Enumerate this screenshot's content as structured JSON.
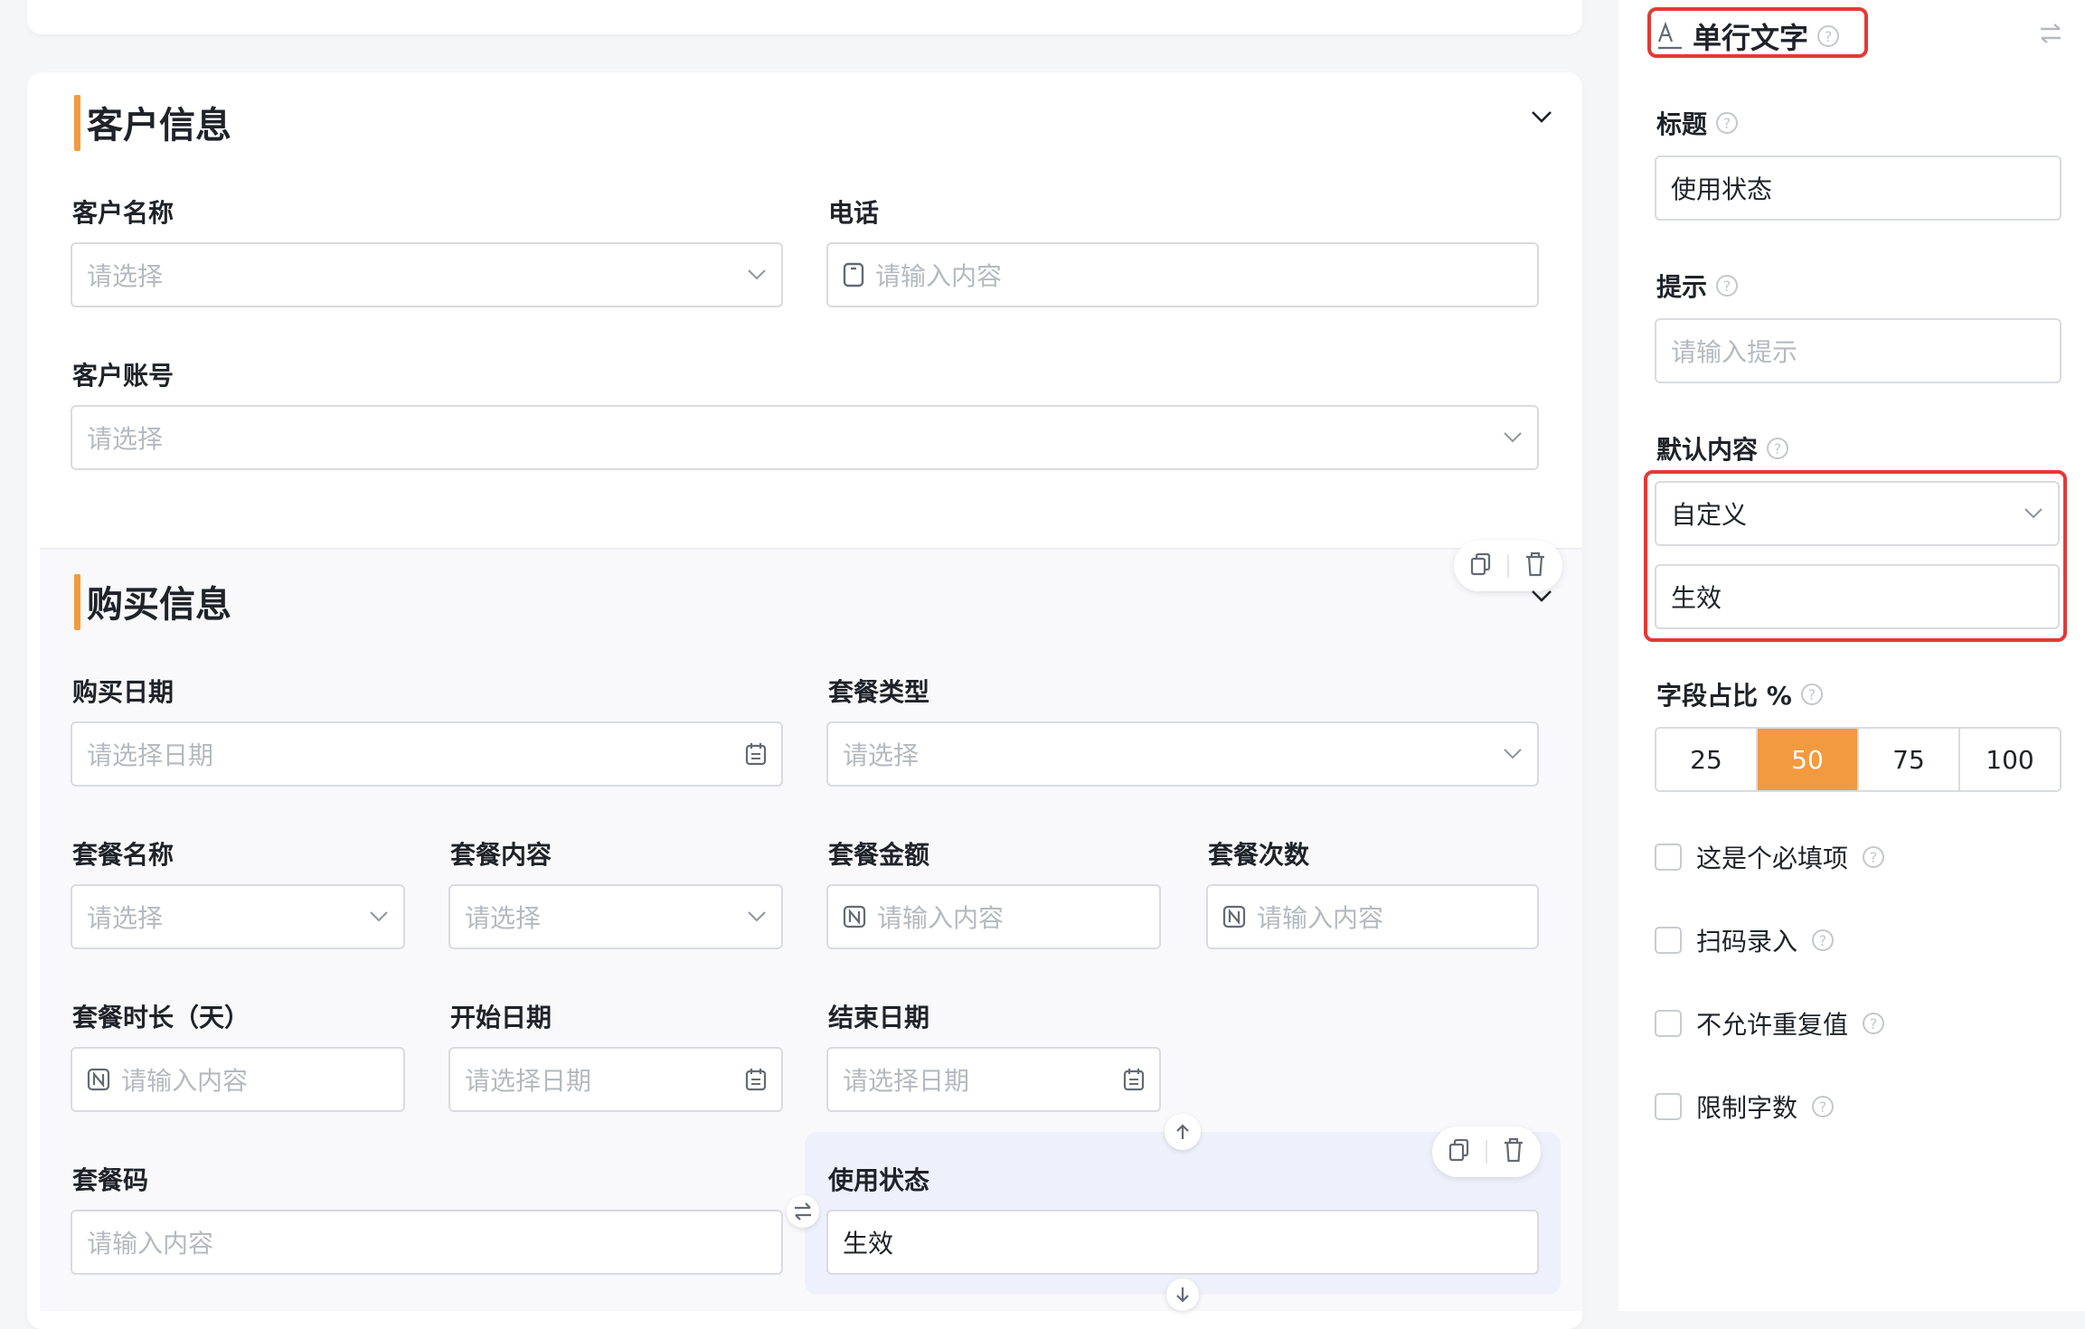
{
  "canvas": {
    "customer_section": {
      "title": "客户信息",
      "fields": {
        "customer_name": {
          "label": "客户名称",
          "placeholder": "请选择"
        },
        "phone": {
          "label": "电话",
          "placeholder": "请输入内容"
        },
        "customer_account": {
          "label": "客户账号",
          "placeholder": "请选择"
        }
      }
    },
    "purchase_section": {
      "title": "购买信息",
      "fields": {
        "purchase_date": {
          "label": "购买日期",
          "placeholder": "请选择日期"
        },
        "package_type": {
          "label": "套餐类型",
          "placeholder": "请选择"
        },
        "package_name": {
          "label": "套餐名称",
          "placeholder": "请选择"
        },
        "package_content": {
          "label": "套餐内容",
          "placeholder": "请选择"
        },
        "package_amount": {
          "label": "套餐金额",
          "placeholder": "请输入内容"
        },
        "package_count": {
          "label": "套餐次数",
          "placeholder": "请输入内容"
        },
        "package_duration": {
          "label": "套餐时长（天）",
          "placeholder": "请输入内容"
        },
        "start_date": {
          "label": "开始日期",
          "placeholder": "请选择日期"
        },
        "end_date": {
          "label": "结束日期",
          "placeholder": "请选择日期"
        },
        "package_code": {
          "label": "套餐码",
          "placeholder": "请输入内容"
        },
        "usage_status": {
          "label": "使用状态",
          "value": "生效"
        }
      }
    }
  },
  "panel": {
    "field_type": "单行文字",
    "title_label": "标题",
    "title_value": "使用状态",
    "hint_label": "提示",
    "hint_placeholder": "请输入提示",
    "default_label": "默认内容",
    "default_mode": "自定义",
    "default_value": "生效",
    "width_label": "字段占比 %",
    "width_options": [
      "25",
      "50",
      "75",
      "100"
    ],
    "width_selected": "50",
    "checkboxes": [
      {
        "label": "这是个必填项",
        "checked": false
      },
      {
        "label": "扫码录入",
        "checked": false
      },
      {
        "label": "不允许重复值",
        "checked": false
      },
      {
        "label": "限制字数",
        "checked": false
      }
    ]
  },
  "colors": {
    "accent": "#f29a3f",
    "highlight_border": "#e53935",
    "selected_field_bg": "#eef0fb"
  },
  "icons": [
    "chevron-down-icon",
    "phone-icon",
    "calendar-icon",
    "number-icon",
    "copy-icon",
    "delete-icon",
    "arrow-up-icon",
    "arrow-down-icon",
    "swap-icon",
    "text-field-icon",
    "help-icon"
  ]
}
